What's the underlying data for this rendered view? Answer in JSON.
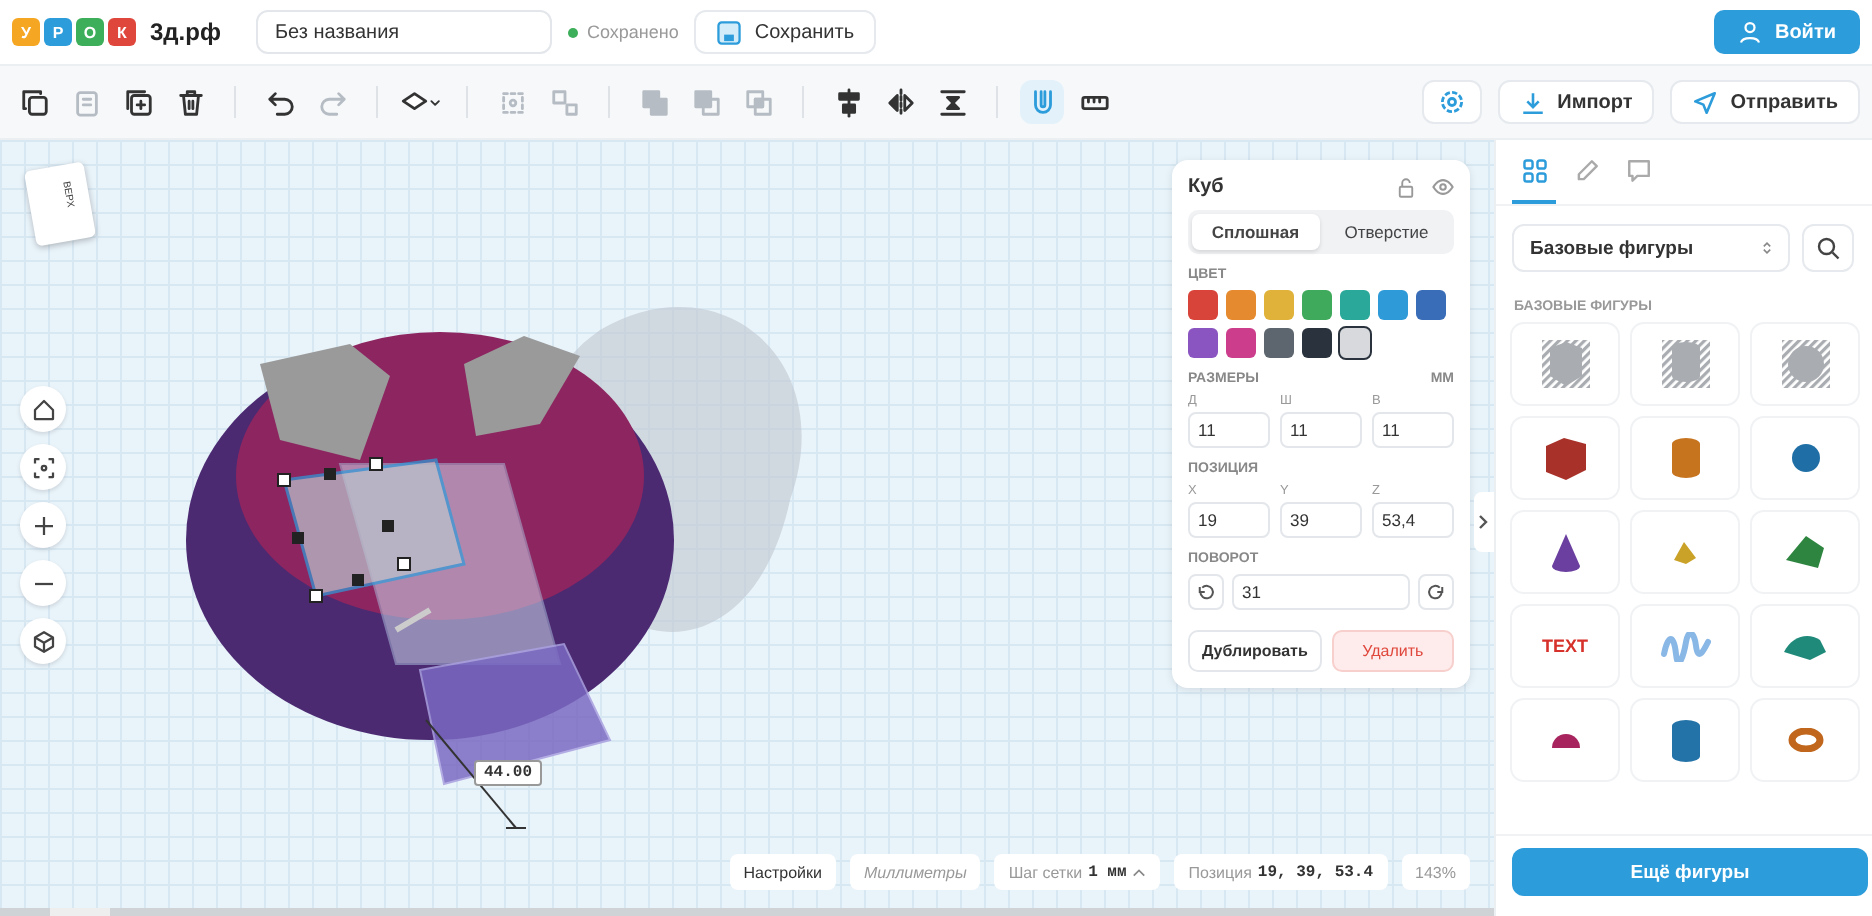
{
  "header": {
    "logo": {
      "letters": [
        {
          "char": "У",
          "color": "#f5a623"
        },
        {
          "char": "Р",
          "color": "#2d9cdb"
        },
        {
          "char": "О",
          "color": "#3dae5a"
        },
        {
          "char": "К",
          "color": "#e0473c"
        }
      ],
      "site": "3д.рф"
    },
    "title_field": {
      "value": "Без названия"
    },
    "save_status": "Сохранено",
    "save_button": "Сохранить",
    "login_button": "Войти"
  },
  "toolbar": {
    "groups": [
      [
        {
          "kind": "copy",
          "disabled": false,
          "active": false
        },
        {
          "kind": "paste",
          "disabled": true,
          "active": false
        },
        {
          "kind": "duplicate",
          "disabled": false,
          "active": false
        },
        {
          "kind": "delete",
          "disabled": false,
          "active": false
        }
      ],
      [
        {
          "kind": "undo",
          "disabled": false,
          "active": false
        },
        {
          "kind": "redo",
          "disabled": true,
          "active": false
        }
      ],
      [
        {
          "kind": "workplane",
          "disabled": false,
          "active": false
        }
      ],
      [
        {
          "kind": "group",
          "disabled": true,
          "active": false
        },
        {
          "kind": "ungroup",
          "disabled": true,
          "active": false
        }
      ],
      [
        {
          "kind": "union",
          "disabled": true,
          "active": false
        },
        {
          "kind": "subtract",
          "disabled": true,
          "active": false
        },
        {
          "kind": "intersect",
          "disabled": true,
          "active": false
        }
      ],
      [
        {
          "kind": "align",
          "disabled": false,
          "active": false
        },
        {
          "kind": "mirror",
          "disabled": false,
          "active": false
        },
        {
          "kind": "distribute",
          "disabled": false,
          "active": false
        }
      ],
      [
        {
          "kind": "magnet",
          "disabled": false,
          "active": true
        },
        {
          "kind": "ruler",
          "disabled": false,
          "active": false
        }
      ]
    ],
    "import_button": "Импорт",
    "send_button": "Отправить"
  },
  "viewport": {
    "view_cube": {
      "top_label": "ВЕРХ"
    },
    "nav_buttons": [
      {
        "kind": "home"
      },
      {
        "kind": "fit"
      },
      {
        "kind": "zoom-in"
      },
      {
        "kind": "zoom-out"
      },
      {
        "kind": "view"
      }
    ],
    "dimension_label": "44.00",
    "status": {
      "settings_button": "Настройки",
      "units": "Миллиметры",
      "grid_label": "Шаг сетки",
      "grid_value": "1 мм",
      "position_label": "Позиция",
      "position_value": "19, 39, 53.4",
      "zoom": "143%"
    }
  },
  "inspector": {
    "title": "Куб",
    "tabs": [
      {
        "label": "Сплошная",
        "selected": true
      },
      {
        "label": "Отверстие",
        "selected": false
      }
    ],
    "color_label": "ЦВЕТ",
    "colors": [
      {
        "color": "#d9443a",
        "selected": false
      },
      {
        "color": "#e58a2e",
        "selected": false
      },
      {
        "color": "#e0b23a",
        "selected": false
      },
      {
        "color": "#3faa5c",
        "selected": false
      },
      {
        "color": "#2aa89a",
        "selected": false
      },
      {
        "color": "#2f9ad8",
        "selected": false
      },
      {
        "color": "#3a6db8",
        "selected": false
      },
      {
        "color": "#8a55c0",
        "selected": false
      },
      {
        "color": "#cc3d8c",
        "selected": false
      },
      {
        "color": "#5d666e",
        "selected": false
      },
      {
        "color": "#2a333d",
        "selected": false
      },
      {
        "color": "#d7d9dc",
        "selected": true
      }
    ],
    "size_label": "РАЗМЕРЫ",
    "size_unit": "ММ",
    "sizes": [
      {
        "label": "Д",
        "value": "11"
      },
      {
        "label": "Ш",
        "value": "11"
      },
      {
        "label": "В",
        "value": "11"
      }
    ],
    "position_label": "ПОЗИЦИЯ",
    "positions": [
      {
        "label": "X",
        "value": "19"
      },
      {
        "label": "Y",
        "value": "39"
      },
      {
        "label": "Z",
        "value": "53,4"
      }
    ],
    "rotation_label": "ПОВОРОТ",
    "rotation_value": "31",
    "duplicate_button": "Дублировать",
    "delete_button": "Удалить"
  },
  "library": {
    "tabs": [
      {
        "kind": "shapes",
        "selected": true
      },
      {
        "kind": "pencil",
        "selected": false
      },
      {
        "kind": "comment",
        "selected": false
      }
    ],
    "category": "Базовые фигуры",
    "section_title": "БАЗОВЫЕ ФИГУРЫ",
    "shapes": [
      {
        "kind": "hole-box",
        "color": "#a9acb1"
      },
      {
        "kind": "hole-cylinder",
        "color": "#a9acb1"
      },
      {
        "kind": "hole-sphere",
        "color": "#a9acb1"
      },
      {
        "kind": "box",
        "color": "#a8322a"
      },
      {
        "kind": "cylinder",
        "color": "#c7741f"
      },
      {
        "kind": "sphere",
        "color": "#1f6fa6"
      },
      {
        "kind": "cone",
        "color": "#6b3fa0"
      },
      {
        "kind": "pyramid",
        "color": "#c9a227"
      },
      {
        "kind": "roof",
        "color": "#2e8540"
      },
      {
        "kind": "text",
        "color": "#d6322b",
        "label": "TEXT"
      },
      {
        "kind": "scribble",
        "color": "#8ab8e6"
      },
      {
        "kind": "half-cylinder",
        "color": "#1f8a7a"
      },
      {
        "kind": "dome",
        "color": "#a8245e"
      },
      {
        "kind": "tube",
        "color": "#2373a8"
      },
      {
        "kind": "torus",
        "color": "#c0671d"
      }
    ],
    "more_button": "Ещё фигуры"
  }
}
